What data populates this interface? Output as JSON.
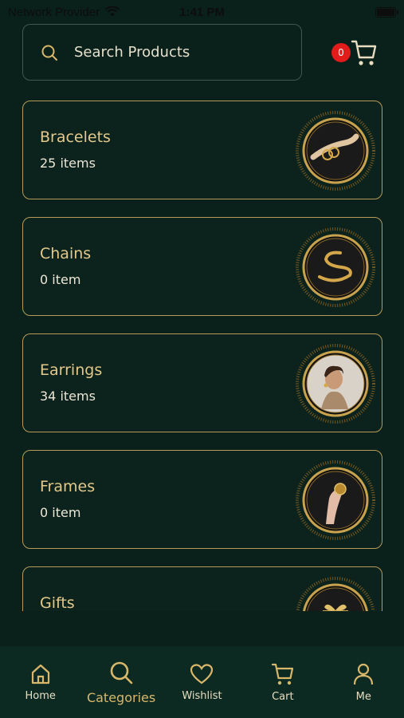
{
  "status_bar": {
    "carrier": "Network Provider",
    "time": "1:41 PM"
  },
  "search": {
    "placeholder": "Search Products"
  },
  "cart": {
    "badge_count": "0"
  },
  "categories": [
    {
      "name": "Bracelets",
      "count": "25 items",
      "image_icon": "bracelet-hand-icon"
    },
    {
      "name": "Chains",
      "count": "0 item",
      "image_icon": "gold-chain-icon"
    },
    {
      "name": "Earrings",
      "count": "34 items",
      "image_icon": "woman-earrings-icon"
    },
    {
      "name": "Frames",
      "count": "0 item",
      "image_icon": "hand-ring-icon"
    },
    {
      "name": "Gifts",
      "count": "",
      "image_icon": "gift-icon"
    }
  ],
  "bottom_nav": {
    "home": "Home",
    "categories": "Categories",
    "wishlist": "Wishlist",
    "cart": "Cart",
    "me": "Me",
    "active": "categories"
  },
  "colors": {
    "background": "#0a201b",
    "gold": "#d9b76a",
    "badge": "#e21b1b"
  }
}
